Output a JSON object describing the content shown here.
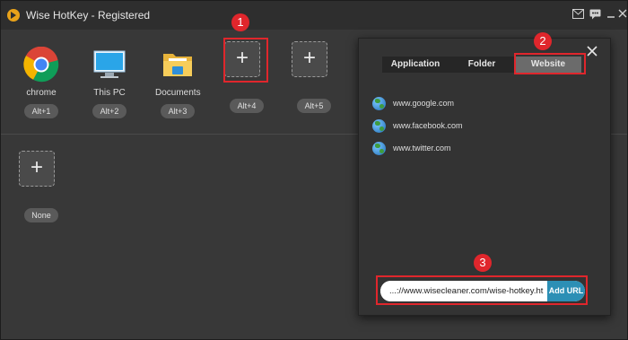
{
  "window": {
    "title": "Wise HotKey - Registered"
  },
  "titlebar_icons": [
    "mail-icon",
    "chat-icon",
    "minimize-icon",
    "close-icon"
  ],
  "shortcuts": [
    {
      "label": "chrome",
      "key": "Alt+1",
      "icon": "chrome-icon"
    },
    {
      "label": "This PC",
      "key": "Alt+2",
      "icon": "monitor-icon"
    },
    {
      "label": "Documents",
      "key": "Alt+3",
      "icon": "folder-icon"
    },
    {
      "label": "",
      "key": "Alt+4",
      "icon": "plus-icon"
    },
    {
      "label": "",
      "key": "Alt+5",
      "icon": "plus-icon"
    }
  ],
  "second_row": [
    {
      "label": "",
      "key": "None",
      "icon": "plus-icon"
    }
  ],
  "panel": {
    "tabs": [
      "Application",
      "Folder",
      "Website"
    ],
    "active_tab": "Website",
    "sites": [
      "www.google.com",
      "www.facebook.com",
      "www.twitter.com"
    ],
    "url_value": "...://www.wisecleaner.com/wise-hotkey.ht",
    "add_url_label": "Add URL"
  },
  "annotations": [
    "1",
    "2",
    "3"
  ],
  "colors": {
    "accent_red": "#e0262c",
    "button_blue": "#2c8fb5",
    "background": "#383838"
  }
}
